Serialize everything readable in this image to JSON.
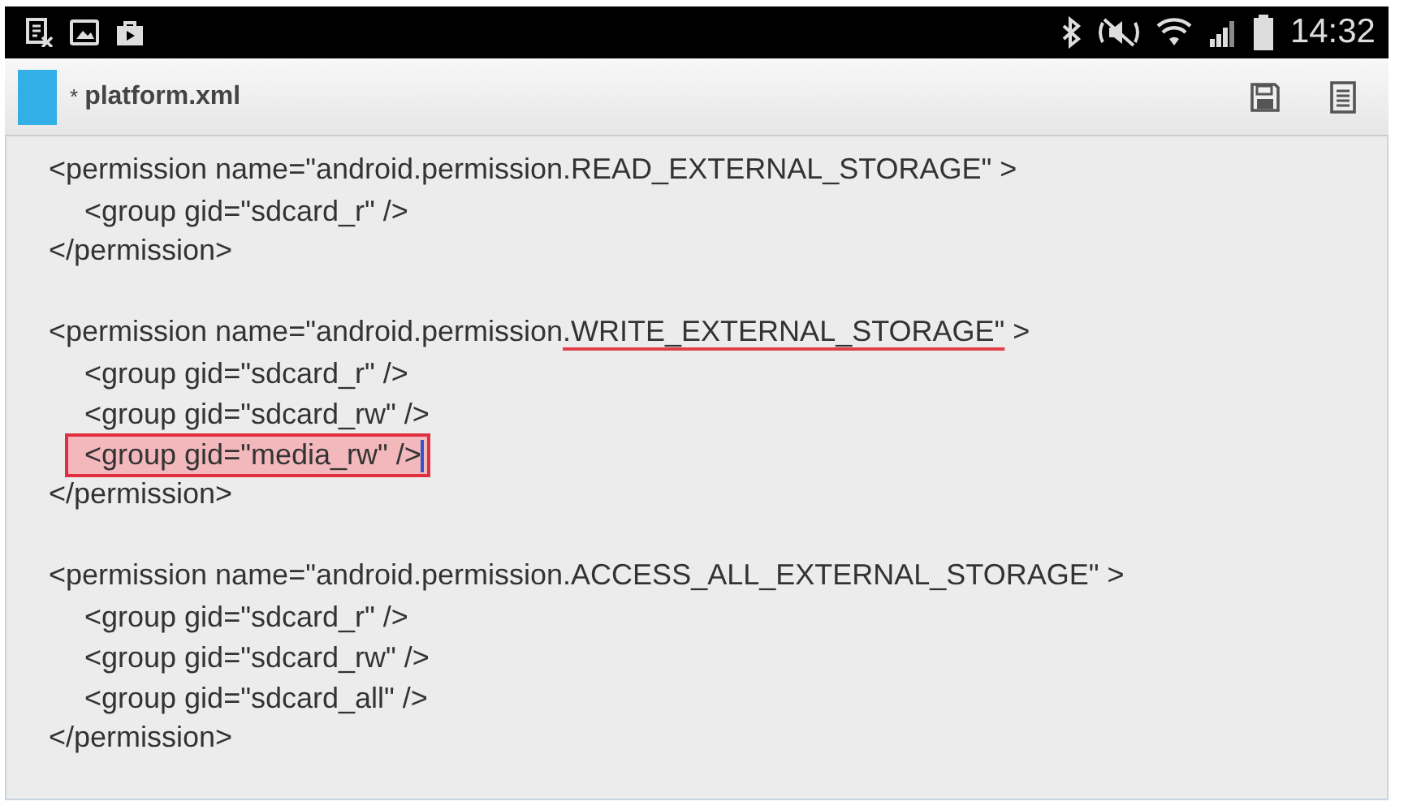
{
  "status_bar": {
    "time": "14:32"
  },
  "title_bar": {
    "modified_mark": "*",
    "file_name": "platform.xml"
  },
  "blocks": [
    {
      "open": [
        {
          "text": "<permission name=\"android.permission.READ_EXTERNAL_STORAGE\" >",
          "underlined": false
        }
      ],
      "children": [
        {
          "text": "<group gid=\"sdcard_r\" />",
          "highlighted": false,
          "cursor": false
        }
      ],
      "close": "</permission>"
    },
    {
      "open": [
        {
          "text": "<permission name=\"android.permission",
          "underlined": false
        },
        {
          "text": ".WRITE_EXTERNAL_STORAGE\"",
          "underlined": true
        },
        {
          "text": " >",
          "underlined": false
        }
      ],
      "children": [
        {
          "text": "<group gid=\"sdcard_r\" />",
          "highlighted": false,
          "cursor": false
        },
        {
          "text": "<group gid=\"sdcard_rw\" />",
          "highlighted": false,
          "cursor": false
        },
        {
          "text": "<group gid=\"media_rw\" />",
          "highlighted": true,
          "cursor": true
        }
      ],
      "close": "</permission>"
    },
    {
      "open": [
        {
          "text": "<permission name=\"android.permission.ACCESS_ALL_EXTERNAL_STORAGE\" >",
          "underlined": false
        }
      ],
      "children": [
        {
          "text": "<group gid=\"sdcard_r\" />",
          "highlighted": false,
          "cursor": false
        },
        {
          "text": "<group gid=\"sdcard_rw\" />",
          "highlighted": false,
          "cursor": false
        },
        {
          "text": "<group gid=\"sdcard_all\" />",
          "highlighted": false,
          "cursor": false
        }
      ],
      "close": "</permission>"
    }
  ]
}
